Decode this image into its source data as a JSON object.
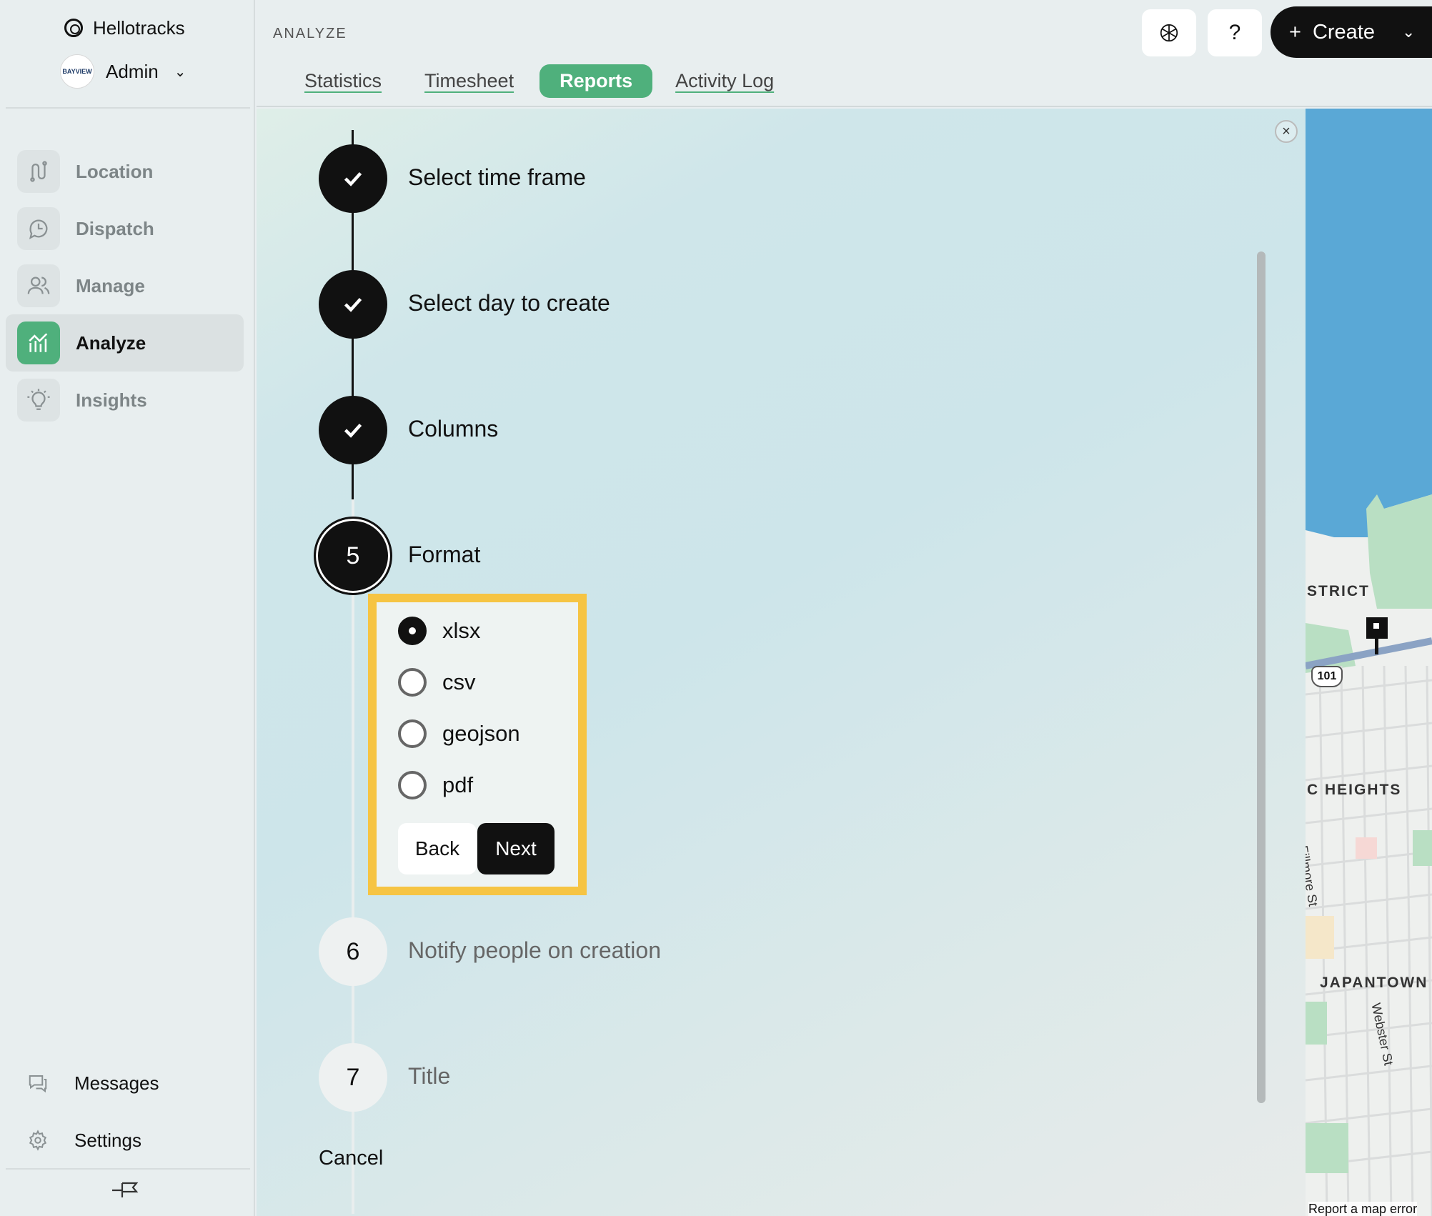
{
  "app": {
    "name": "Hellotracks"
  },
  "account": {
    "role": "Admin",
    "avatar_text": "BAYVIEW"
  },
  "sidebar": {
    "items": [
      {
        "label": "Location",
        "icon": "route-icon"
      },
      {
        "label": "Dispatch",
        "icon": "clock-bubble-icon"
      },
      {
        "label": "Manage",
        "icon": "users-icon"
      },
      {
        "label": "Analyze",
        "icon": "chart-icon",
        "active": true
      },
      {
        "label": "Insights",
        "icon": "lightbulb-icon"
      }
    ],
    "footer": [
      {
        "label": "Messages",
        "icon": "chat-icon"
      },
      {
        "label": "Settings",
        "icon": "gear-icon"
      }
    ]
  },
  "header": {
    "section": "ANALYZE",
    "tabs": [
      "Statistics",
      "Timesheet",
      "Reports",
      "Activity Log"
    ],
    "active_tab": "Reports",
    "help_label": "?",
    "create_label": "Create"
  },
  "steps": [
    {
      "title": "Select time frame",
      "state": "done"
    },
    {
      "title": "Select day to create",
      "state": "done"
    },
    {
      "title": "Columns",
      "state": "done"
    },
    {
      "number": "5",
      "title": "Format",
      "state": "current"
    },
    {
      "number": "6",
      "title": "Notify people on creation",
      "state": "pending"
    },
    {
      "number": "7",
      "title": "Title",
      "state": "pending"
    }
  ],
  "format": {
    "options": [
      "xlsx",
      "csv",
      "geojson",
      "pdf"
    ],
    "selected": "xlsx",
    "back_label": "Back",
    "next_label": "Next"
  },
  "cancel_label": "Cancel",
  "close_label": "×",
  "map": {
    "labels": [
      "STRICT",
      "C HEIGHTS",
      "JAPANTOWN"
    ],
    "streets": [
      "Fillmore St",
      "Webster St"
    ],
    "highway": "101",
    "error_link": "Report a map error"
  },
  "colors": {
    "accent": "#4fb07c",
    "highlight": "#f6c443",
    "dark": "#111111"
  }
}
